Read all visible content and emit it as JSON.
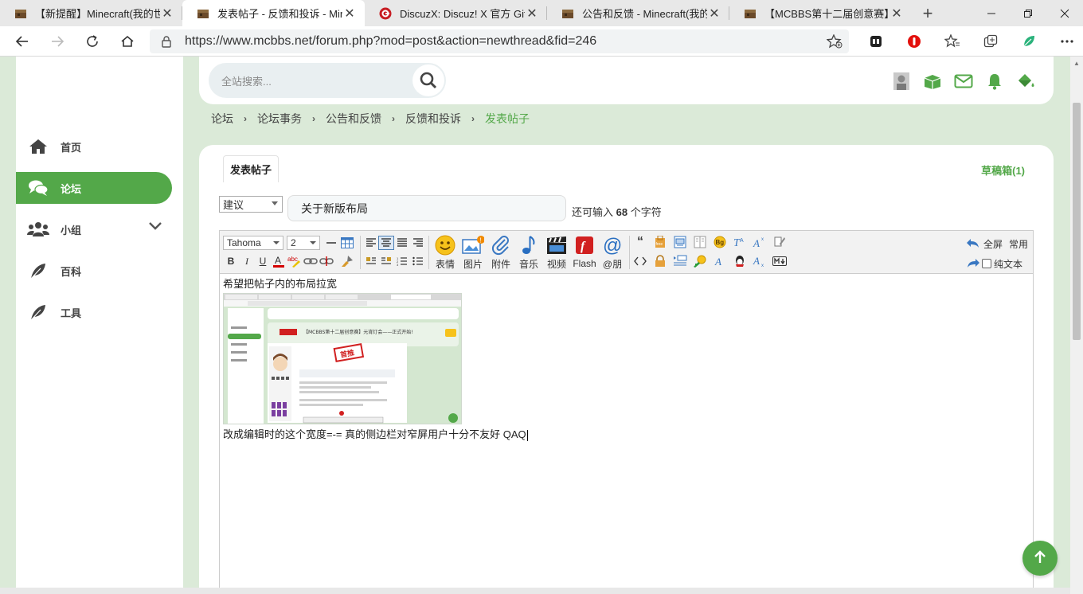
{
  "browser": {
    "tabs": [
      {
        "title": "【新提醒】Minecraft(我的世界",
        "favicon": "minecraft-block-icon",
        "active": false
      },
      {
        "title": "发表帖子 - 反馈和投诉 - Minec",
        "favicon": "minecraft-block-icon",
        "active": true
      },
      {
        "title": "DiscuzX: Discuz! X 官方 Git，",
        "favicon": "gitee-icon",
        "active": false
      },
      {
        "title": "公告和反馈 - Minecraft(我的世",
        "favicon": "minecraft-block-icon",
        "active": false
      },
      {
        "title": "【MCBBS第十二届创意赛】元",
        "favicon": "minecraft-block-icon",
        "active": false
      }
    ],
    "close_glyph": "✕",
    "newtab_glyph": "+",
    "url": "https://www.mcbbs.net/forum.php?mod=post&action=newthread&fid=246",
    "brand_color": "#53a849"
  },
  "search": {
    "placeholder": "全站搜索..."
  },
  "sidebar": {
    "items": [
      {
        "label": "首页",
        "icon": "home-icon"
      },
      {
        "label": "论坛",
        "icon": "comments-icon",
        "active": true
      },
      {
        "label": "小组",
        "icon": "users-icon"
      },
      {
        "label": "百科",
        "icon": "feather-icon"
      },
      {
        "label": "工具",
        "icon": "feather-icon"
      }
    ]
  },
  "breadcrumb": {
    "items": [
      "论坛",
      "论坛事务",
      "公告和反馈",
      "反馈和投诉",
      "发表帖子"
    ],
    "sep": "›"
  },
  "post": {
    "tab_label": "发表帖子",
    "drafts_label": "草稿箱(1)",
    "type_value": "建议",
    "subject_value": "关于新版布局",
    "remain_prefix": "还可输入",
    "remain_count": "68",
    "remain_suffix": "个字符"
  },
  "editor": {
    "font_value": "Tahoma",
    "size_value": "2",
    "big_buttons": [
      "表情",
      "图片",
      "附件",
      "音乐",
      "视频",
      "Flash",
      "@朋"
    ],
    "fullscreen_label": "全屏",
    "common_label": "常用",
    "plaintext_label": "纯文本",
    "content_line1": "希望把帖子内的布局拉宽",
    "content_line2": "改成编辑时的这个宽度=-= 真的侧边栏对窄屏用户十分不友好 QAQ",
    "embedded_image": {
      "title_text": "【MCBBS第十二届创意赛】元宵灯会——正式开始!",
      "stamp_text": "首推"
    }
  }
}
